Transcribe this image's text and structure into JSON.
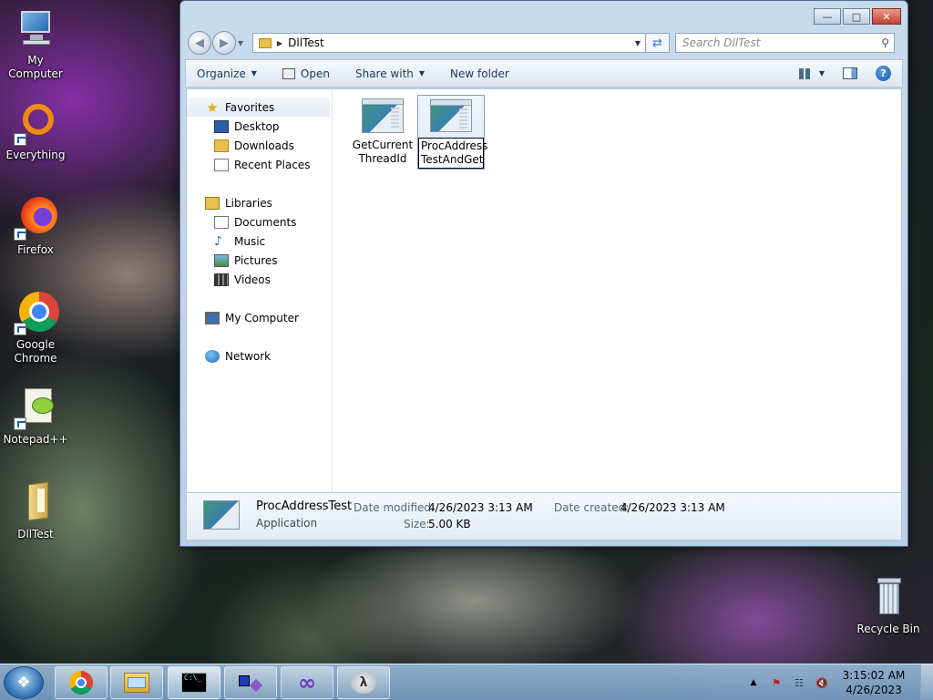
{
  "desktop": {
    "icons": [
      {
        "label": "My Computer"
      },
      {
        "label": "Everything"
      },
      {
        "label": "Firefox"
      },
      {
        "label": "Google Chrome"
      },
      {
        "label": "Notepad++"
      },
      {
        "label": "DllTest"
      },
      {
        "label": "Recycle Bin"
      }
    ]
  },
  "window": {
    "address": {
      "folder": "DllTest"
    },
    "search": {
      "placeholder": "Search DllTest"
    },
    "toolbar": {
      "organize": "Organize",
      "open": "Open",
      "share_with": "Share with",
      "new_folder": "New folder"
    },
    "nav": {
      "favorites": "Favorites",
      "desktop": "Desktop",
      "downloads": "Downloads",
      "recent_places": "Recent Places",
      "libraries": "Libraries",
      "documents": "Documents",
      "music": "Music",
      "pictures": "Pictures",
      "videos": "Videos",
      "my_computer": "My Computer",
      "network": "Network"
    },
    "files": [
      {
        "line1": "GetCurrent",
        "line2": "ThreadId"
      },
      {
        "line1": "ProcAddress",
        "line2": "TestAndGet",
        "renaming": true
      }
    ],
    "details": {
      "name": "ProcAddressTest",
      "type": "Application",
      "date_modified_label": "Date modified:",
      "date_modified": "4/26/2023 3:13 AM",
      "date_created_label": "Date created:",
      "date_created": "4/26/2023 3:13 AM",
      "size_label": "Size:",
      "size": "5.00 KB"
    }
  },
  "taskbar": {
    "clock_time": "3:15:02 AM",
    "clock_date": "4/26/2023",
    "pinned": [
      "chrome-icon",
      "explorer-icon",
      "cmd-icon",
      "flow-icon",
      "visual-studio-icon",
      "lambda-icon"
    ]
  },
  "colors": {
    "accent": "#2c7bd0",
    "close_button": "#c7412d",
    "taskbar": "#8fb4da"
  }
}
